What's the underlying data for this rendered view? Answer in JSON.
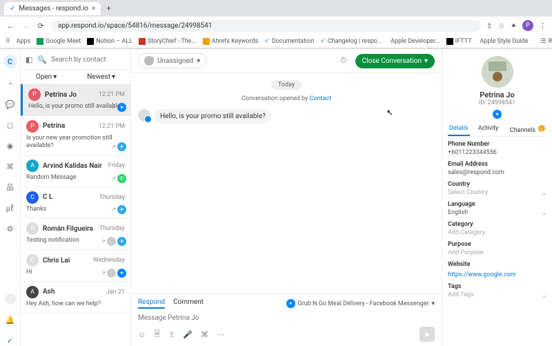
{
  "browser": {
    "tab_title": "Messages - respond.io",
    "url": "app.respond.io/space/54816/message/24998541",
    "bookmarks": [
      "Apps",
      "Google Meet",
      "Notion – ALL",
      "StoryChief - The...",
      "Ahrefs Keywords",
      "Documentation",
      "Changelog | respo...",
      "Apple Developer...",
      "IFTTT",
      "Apple Style Guide",
      "Reading List"
    ]
  },
  "list": {
    "search_placeholder": "Search by contact",
    "tab_open": "Open",
    "tab_sort": "Newest",
    "items": [
      {
        "name": "Petrina Jo",
        "time": "12:21 PM",
        "msg": "Hello, is your promo still available?",
        "channel": "fb",
        "selected": true,
        "avatar_bg": "#e85b66"
      },
      {
        "name": "Petrina",
        "time": "12:21 PM",
        "msg": "Is your new year promotion still available?",
        "channel": "tg",
        "avatar_bg": "#e85b66"
      },
      {
        "name": "Arvind Kalidas Nair",
        "time": "Friday",
        "msg": "Random Message",
        "channel": "wa",
        "avatar_bg": "#14a6c9"
      },
      {
        "name": "C L",
        "time": "Thursday",
        "msg": "Thanks",
        "channel": "tg",
        "avatar_bg": "#1f5fea"
      },
      {
        "name": "Román Filgueira",
        "time": "Thursday",
        "msg": "Testing notification",
        "channel": "tg",
        "avatar_bg": "#ddd",
        "extra_avatar": true
      },
      {
        "name": "Chris Lai",
        "time": "Wednesday",
        "msg": "Hi",
        "channel": "fb",
        "avatar_bg": "#ddd",
        "extra_avatar": true
      },
      {
        "name": "Ash",
        "time": "Jan 21",
        "msg": "Hey Ash, how can we help?",
        "channel": "",
        "avatar_bg": "#444"
      }
    ]
  },
  "chat": {
    "assignee": "Unassigned",
    "close_btn": "Close Conversation",
    "date": "Today",
    "opened_pre": "Conversation opened by ",
    "opened_link": "Contact",
    "message": "Hello, is your promo still available?",
    "respond_tab": "Respond",
    "comment_tab": "Comment",
    "channel_label": "Grub N Go Meal Delivery - Facebook Messenger",
    "input_placeholder": "Message Petrina Jo"
  },
  "detail": {
    "name": "Petrina Jo",
    "id": "ID: 24998541",
    "tabs": {
      "details": "Details",
      "activity": "Activity",
      "channels": "Channels",
      "channels_badge": "1"
    },
    "fields": {
      "phone_l": "Phone Number",
      "phone_v": "+6011223344556",
      "email_l": "Email Address",
      "email_v": "sales@respond.com",
      "country_l": "Country",
      "country_v": "Select Country",
      "lang_l": "Language",
      "lang_v": "English",
      "cat_l": "Category",
      "cat_v": "Add Category",
      "purpose_l": "Purpose",
      "purpose_v": "Add Purpose",
      "web_l": "Website",
      "web_v": "https://www.google.com",
      "tags_l": "Tags",
      "tags_v": "Add Tags"
    }
  }
}
